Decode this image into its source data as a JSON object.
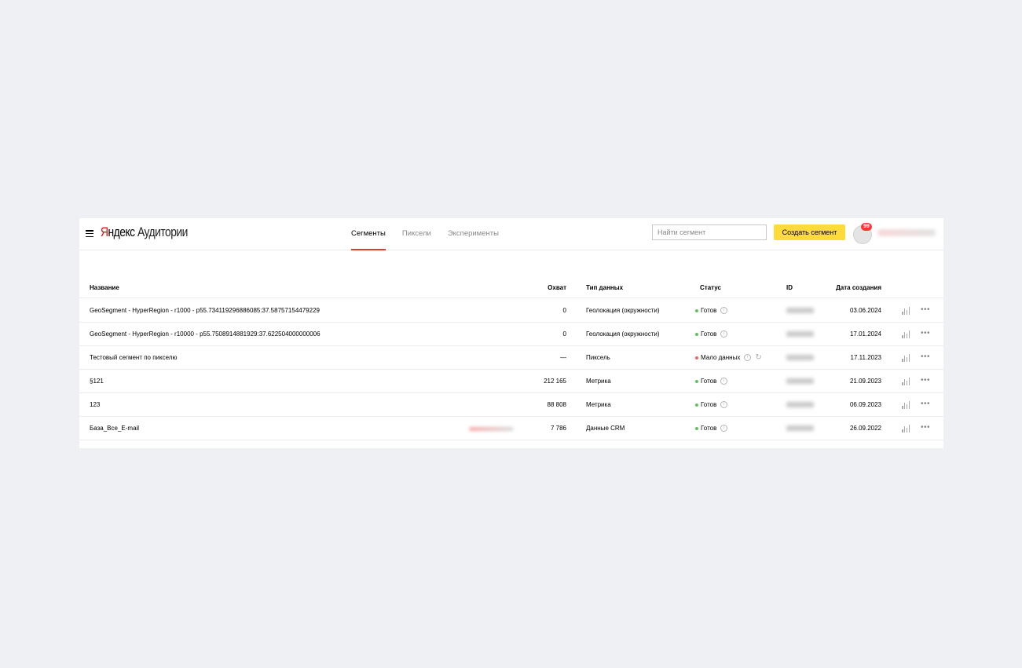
{
  "header": {
    "logo_brand": "Яндекс",
    "logo_brand_first": "Я",
    "logo_brand_rest": "ндекс",
    "logo_product": "Аудитории",
    "tabs": [
      {
        "label": "Сегменты",
        "active": true
      },
      {
        "label": "Пиксели",
        "active": false
      },
      {
        "label": "Эксперименты",
        "active": false
      }
    ],
    "search_placeholder": "Найти сегмент",
    "create_button": "Создать сегмент",
    "notifications_count": "99"
  },
  "table": {
    "columns": {
      "name": "Название",
      "reach": "Охват",
      "type": "Тип данных",
      "status": "Статус",
      "id": "ID",
      "date": "Дата создания"
    },
    "rows": [
      {
        "name": "GeoSegment - HyperRegion - r1000 - p55.734119296886085:37.58757154479229",
        "reach": "0",
        "type": "Геолокация (окружности)",
        "status": "Готов",
        "status_color": "green",
        "date": "03.06.2024"
      },
      {
        "name": "GeoSegment - HyperRegion - r10000 - p55.7508914881929:37.622504000000006",
        "reach": "0",
        "type": "Геолокация (окружности)",
        "status": "Готов",
        "status_color": "green",
        "date": "17.01.2024"
      },
      {
        "name": "Тестовый сегмент по пикселю",
        "reach": "—",
        "type": "Пиксель",
        "status": "Мало данных",
        "status_color": "red",
        "date": "17.11.2023"
      },
      {
        "name": "§121",
        "reach": "212 165",
        "type": "Метрика",
        "status": "Готов",
        "status_color": "green",
        "date": "21.09.2023"
      },
      {
        "name": "123",
        "reach": "88 808",
        "type": "Метрика",
        "status": "Готов",
        "status_color": "green",
        "date": "06.09.2023"
      },
      {
        "name": "База_Все_E-mail",
        "reach": "7 786",
        "type": "Данные CRM",
        "status": "Готов",
        "status_color": "green",
        "date": "26.09.2022"
      }
    ]
  },
  "icons": {
    "menu": "hamburger-icon",
    "info": "info-icon",
    "refresh": "refresh-icon",
    "stats": "bar-chart-icon",
    "more": "more-dots-icon"
  },
  "colors": {
    "accent_yellow": "#fddb3a",
    "tab_underline": "#e43a2d",
    "status_ready": "#62c461",
    "status_low": "#f36359",
    "page_bg": "#eef0f4"
  }
}
